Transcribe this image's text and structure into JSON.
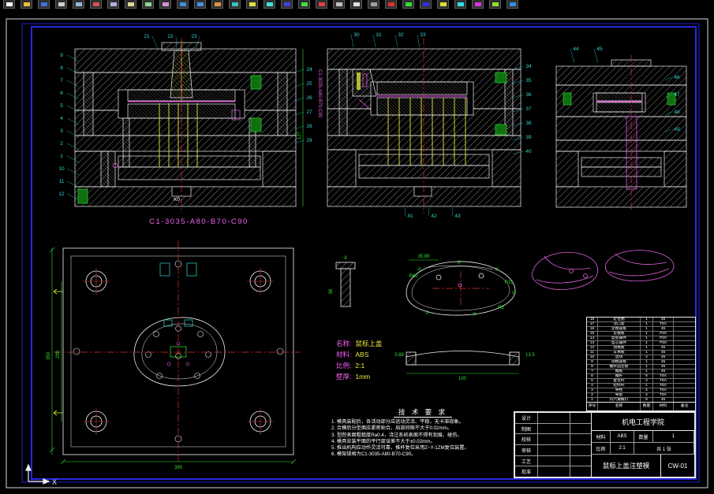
{
  "app": {
    "toolbar_icons": [
      {
        "n": "new-icon",
        "c": "#f8f8f8"
      },
      {
        "n": "open-icon",
        "c": "#e6c23c"
      },
      {
        "n": "save-icon",
        "c": "#3f6fd8"
      },
      {
        "n": "print-icon",
        "c": "#cfcfcf"
      },
      {
        "n": "print-preview-icon",
        "c": "#8fb8d8"
      },
      {
        "n": "spelling-icon",
        "c": "#d85050"
      },
      {
        "n": "cut-icon",
        "c": "#b0b0e0"
      },
      {
        "n": "copy-icon",
        "c": "#d8d890"
      },
      {
        "n": "paste-icon",
        "c": "#90d890"
      },
      {
        "n": "match-properties-icon",
        "c": "#d890d8"
      },
      {
        "n": "undo-icon",
        "c": "#4090e0"
      },
      {
        "n": "redo-icon",
        "c": "#4090e0"
      },
      {
        "n": "insert-block-icon",
        "c": "#e09040"
      },
      {
        "n": "xref-icon",
        "c": "#40c0c0"
      },
      {
        "n": "pan-icon",
        "c": "#e0e040"
      },
      {
        "n": "zoom-realtime-icon",
        "c": "#40e0e0"
      },
      {
        "n": "zoom-window-icon",
        "c": "#4040e0"
      },
      {
        "n": "zoom-previous-icon",
        "c": "#40e040"
      },
      {
        "n": "aerial-view-icon",
        "c": "#e04040"
      },
      {
        "n": "redraw-icon",
        "c": "#c0c0c0"
      },
      {
        "n": "layers-icon",
        "c": "#e0e0e0"
      },
      {
        "n": "layer-control-icon",
        "c": "#a0a0a0"
      },
      {
        "n": "color-control-icon",
        "c": "#e03030"
      },
      {
        "n": "linetype-icon",
        "c": "#30e030"
      },
      {
        "n": "lineweight-icon",
        "c": "#3030e0"
      },
      {
        "n": "properties-icon",
        "c": "#e0e030"
      },
      {
        "n": "distance-icon",
        "c": "#30e0e0"
      },
      {
        "n": "area-icon",
        "c": "#e030e0"
      },
      {
        "n": "osnap-icon",
        "c": "#90e030"
      },
      {
        "n": "help-icon",
        "c": "#3090e0"
      }
    ]
  },
  "frame": {
    "ucs_x_label": "X"
  },
  "drawing": {
    "model_code": "C1-3035-A80-B70-C90",
    "vertical_code": "C1-3035-A80-B70-C90",
    "view1_note": "K0",
    "callouts": {
      "v1_top": [
        "21",
        "22",
        "23"
      ],
      "v1_left": [
        "9",
        "8",
        "7",
        "6",
        "5",
        "4",
        "3",
        "2",
        "1",
        "10",
        "11",
        "12"
      ],
      "v1_right": [
        "24",
        "25",
        "26",
        "27",
        "28",
        "29"
      ],
      "v2_top": [
        "30",
        "31",
        "32",
        "33"
      ],
      "v2_right": [
        "34",
        "35",
        "36",
        "37",
        "38",
        "39",
        "40"
      ],
      "v2_bottom": [
        "41",
        "42",
        "43"
      ],
      "v3_top": [
        "44",
        "45"
      ],
      "v3_right": [
        "46",
        "47",
        "48",
        "49"
      ]
    },
    "dims": {
      "v1_right": "127",
      "plan_left_outer": "350",
      "plan_left_inner": "280",
      "plan_bottom": "390",
      "mouse_top": "35.89",
      "mouse_r1": "R60",
      "mouse_r2": "R15",
      "mouse_r3": "R8",
      "strip_left": "3.88",
      "strip_right": "13.5",
      "strip_bottom": "100",
      "small_top": "8",
      "small_left": "36"
    },
    "part_info": {
      "rows": [
        {
          "label": "名称:",
          "value": "鼠标上盖"
        },
        {
          "label": "材料:",
          "value": "ABS"
        },
        {
          "label": "比例:",
          "value": "2:1"
        },
        {
          "label": "壁厚:",
          "value": "1mm"
        }
      ]
    },
    "tech": {
      "title": "技 术 要 求",
      "lines": [
        "1. 模具装配后，各活动部分应运动灵活、平稳，无卡滞现象。",
        "2. 合模后分型面应紧密贴合，局部间隙不大于0.02mm。",
        "3. 型腔表面粗糙度Ra0.4，浇注系统表面不得有划痕、碰伤。",
        "4. 模具安装平面的平行度误差不大于±0.02mm。",
        "5. 推出机构应动作灵活可靠，推杆复位采用Z~Y-1ZM复位装置。",
        "6. 模架规格为C1-3035-A80-B70-C90。"
      ]
    },
    "bom": {
      "headers": [
        "序号",
        "名称",
        "数量",
        "材料",
        "备注"
      ],
      "rows": [
        [
          "18",
          "定位圈",
          "1",
          "45",
          ""
        ],
        [
          "17",
          "浇口套",
          "1",
          "T8A",
          ""
        ],
        [
          "16",
          "定模座板",
          "1",
          "45",
          ""
        ],
        [
          "15",
          "定模板",
          "1",
          "P20",
          ""
        ],
        [
          "14",
          "型腔镶件",
          "1",
          "P20",
          ""
        ],
        [
          "13",
          "型芯镶件",
          "1",
          "P20",
          ""
        ],
        [
          "12",
          "动模板",
          "1",
          "45",
          ""
        ],
        [
          "11",
          "支承板",
          "1",
          "45",
          ""
        ],
        [
          "10",
          "垫块",
          "2",
          "45",
          ""
        ],
        [
          "9",
          "动模座板",
          "1",
          "45",
          ""
        ],
        [
          "8",
          "推杆固定板",
          "1",
          "45",
          ""
        ],
        [
          "7",
          "推板",
          "1",
          "45",
          ""
        ],
        [
          "6",
          "推杆",
          "6",
          "T8A",
          ""
        ],
        [
          "5",
          "复位杆",
          "4",
          "T8A",
          ""
        ],
        [
          "4",
          "拉料杆",
          "1",
          "T8A",
          ""
        ],
        [
          "3",
          "导柱",
          "4",
          "T8A",
          ""
        ],
        [
          "2",
          "导套",
          "4",
          "T8A",
          ""
        ],
        [
          "1",
          "内六角螺钉",
          "8",
          "45",
          ""
        ]
      ]
    },
    "title_block": {
      "rows_left": [
        "设计",
        "制图",
        "校核",
        "审核",
        "工艺",
        "批准"
      ],
      "school": "机电工程学院",
      "material_label": "材料",
      "material": "ABS",
      "qty_label": "数量",
      "qty": "1",
      "scale_label": "比例",
      "scale": "2:1",
      "sheet_label": "共 1 张",
      "name": "鼠标上盖注塑模",
      "number": "CW-01"
    }
  }
}
